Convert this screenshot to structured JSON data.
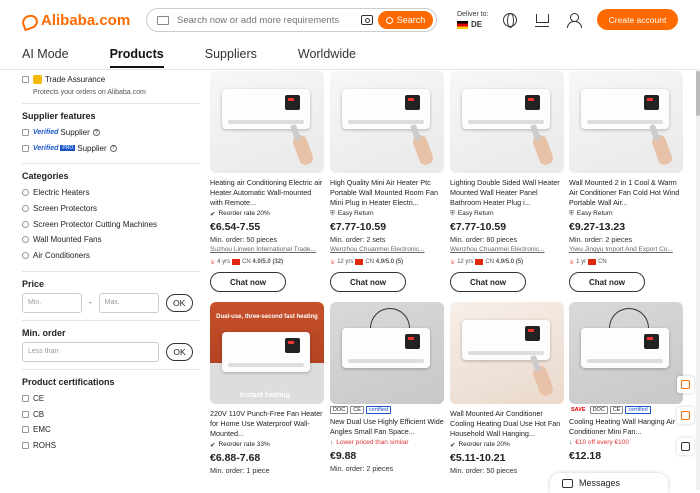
{
  "header": {
    "logo_text": "Alibaba.com",
    "search_placeholder": "Search now or add more requirements",
    "search_button": "Search",
    "deliver_label": "Deliver to:",
    "deliver_country": "DE",
    "create_account": "Create account",
    "accent_color": "#ff6a00"
  },
  "tabs": [
    {
      "label": "AI Mode"
    },
    {
      "label": "Products",
      "active": true
    },
    {
      "label": "Suppliers"
    },
    {
      "label": "Worldwide"
    }
  ],
  "sidebar": {
    "trade_assurance": "Trade Assurance",
    "trade_assurance_note": "Protects your orders on Alibaba.com",
    "supplier_features_title": "Supplier features",
    "verified_supplier": "Supplier",
    "verified_pro_supplier": "Supplier",
    "verified_word": "Verified",
    "pro_word": "PRO",
    "categories_title": "Categories",
    "categories": [
      "Electric Heaters",
      "Screen Protectors",
      "Screen Protector Cutting Machines",
      "Wall Mounted Fans",
      "Air Conditioners"
    ],
    "price_title": "Price",
    "price_min_placeholder": "Min.",
    "price_max_placeholder": "Max.",
    "ok": "OK",
    "moq_title": "Min. order",
    "moq_placeholder": "Less than",
    "cert_title": "Product certifications",
    "certs": [
      "CE",
      "CB",
      "EMC",
      "ROHS"
    ]
  },
  "products": [
    {
      "title": "Heating air Conditioning Electric air Heater Automatic Wall-mounted with Remote...",
      "badges": [],
      "line1": "Reorder rate 20%",
      "line1_type": "reorder",
      "price": "€6.54-7.55",
      "moq": "Min. order: 50 pieces",
      "supplier": "Suzhou Linwen International Trade...",
      "years": "4 yrs",
      "country": "CN",
      "rating": "4.0/5.0 (32)",
      "chat": "Chat now",
      "img": "light"
    },
    {
      "title": "High Quality Mini Air Heater Ptc Portable Wall Mounted Room Fan Mini Plug in Heater Electri...",
      "badges": [],
      "line1": "Easy Return",
      "line1_type": "easy",
      "price": "€7.77-10.59",
      "moq": "Min. order: 2 sets",
      "supplier": "Wenzhou Chuanmei Electronic...",
      "years": "12 yrs",
      "country": "CN",
      "rating": "4.9/5.0 (5)",
      "chat": "Chat now",
      "img": "light"
    },
    {
      "title": "Lighting Double Sided Wall Heater Mounted Wall Heater Panel Bathroom Heater Plug i...",
      "badges": [],
      "line1": "Easy Return",
      "line1_type": "easy",
      "price": "€7.77-10.59",
      "moq": "Min. order: 80 pieces",
      "supplier": "Wenzhou Chuanmei Electronic...",
      "years": "12 yrs",
      "country": "CN",
      "rating": "4.9/5.0 (5)",
      "chat": "Chat now",
      "img": "light"
    },
    {
      "title": "Wall Mounted 2 in 1 Cool & Warm Air Conditioner Fan Cold Hot Wind Portable Wall Air...",
      "badges": [],
      "line1": "Easy Return",
      "line1_type": "easy",
      "price": "€9.27-13.23",
      "moq": "Min. order: 2 pieces",
      "supplier": "Yiwu Jingyu Import And Export Co...",
      "years": "1 yr",
      "country": "CN",
      "rating": "",
      "chat": "Chat now",
      "img": "light"
    },
    {
      "title": "220V 110V Punch-Free Fan Heater for Home Use Waterproof Wall-Mounted...",
      "badges": [],
      "line1": "Reorder rate 33%",
      "line1_type": "reorder",
      "price": "€6.88-7.68",
      "moq": "Min. order: 1 piece",
      "img": "orange",
      "banner": "Dual-use, three-second fast heating",
      "banner2": "Instant heating"
    },
    {
      "title": "New Dual Use Highly Efficient Wide Angles Small Fan Space...",
      "badges": [
        "DOC",
        "CE",
        "certified"
      ],
      "line1": "Lower priced than similar",
      "line1_type": "lower",
      "price": "€9.88",
      "moq": "Min. order: 2 pieces",
      "img": "grey"
    },
    {
      "title": "Wall Mounted Air Conditioner Cooling Heating Dual Use Hot Fan Household Wall Hanging...",
      "badges": [],
      "line1": "Reorder rate 20%",
      "line1_type": "reorder",
      "price": "€5.11-10.21",
      "moq": "Min. order: 50 pieces",
      "img": "peach"
    },
    {
      "title": "Cooling Heating Wall Hanging Air Conditioner Mini Fan...",
      "badges": [
        "SAVE",
        "DOC",
        "CE",
        "certified"
      ],
      "line1": "€10 off every €100",
      "line1_type": "lower",
      "price": "€12.18",
      "moq": "",
      "img": "grey"
    }
  ],
  "messages": "Messages"
}
